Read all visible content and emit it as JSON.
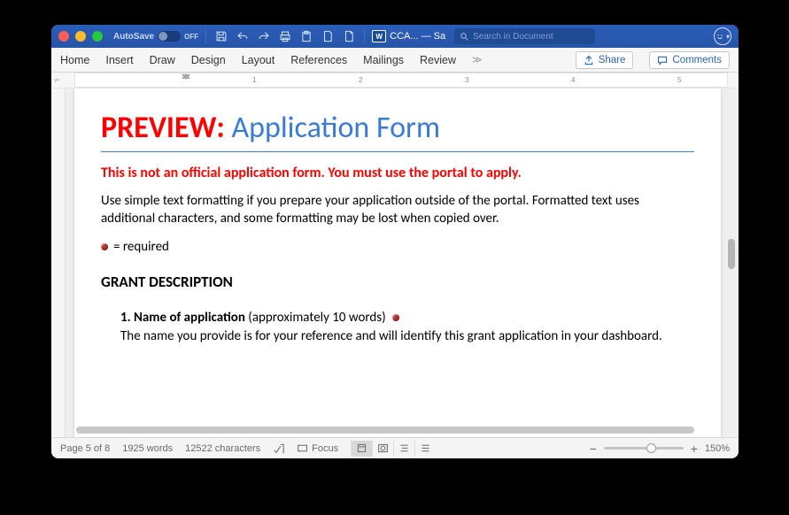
{
  "titlebar": {
    "autosave": "AutoSave",
    "autosave_state": "OFF",
    "doc_title": "CCA... — Sa",
    "search_placeholder": "Search in Document"
  },
  "ribbon": {
    "tabs": [
      "Home",
      "Insert",
      "Draw",
      "Design",
      "Layout",
      "References",
      "Mailings",
      "Review"
    ],
    "share": "Share",
    "comments": "Comments"
  },
  "ruler": {
    "marks": [
      "1",
      "2",
      "3",
      "4",
      "5"
    ]
  },
  "document": {
    "preview": "PREVIEW:",
    "title": "Application Form",
    "warning": "This is not an official application form. You must use the portal to apply.",
    "intro": "Use simple text formatting if you prepare your application outside of the portal. Formatted text uses additional characters, and some formatting may be lost when copied over.",
    "required_text": "= required",
    "section": "GRANT DESCRIPTION",
    "q1_num": "1.",
    "q1_name": "Name of application",
    "q1_paren": "(approximately 10 words)",
    "q1_desc": "The name you provide is for your reference and will identify this grant application in your dashboard."
  },
  "statusbar": {
    "page": "Page 5 of 8",
    "words": "1925 words",
    "chars": "12522 characters",
    "focus": "Focus",
    "zoom": "150%"
  }
}
